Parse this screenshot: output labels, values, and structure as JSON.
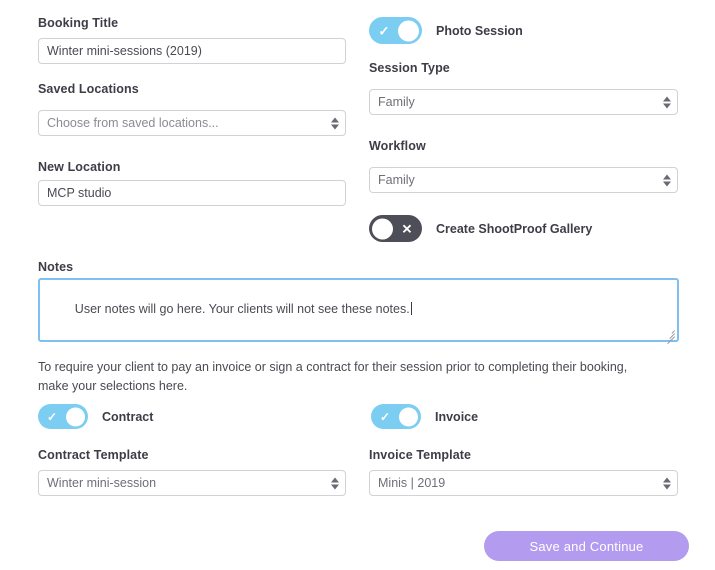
{
  "colors": {
    "toggle_on": "#7ccdf2",
    "toggle_off": "#4e4e59",
    "focus_border": "#7ec0ef",
    "primary_button": "#b39cf0",
    "label_text": "#3d3d47",
    "input_border": "#d2d2d2"
  },
  "left_column": {
    "booking_title": {
      "label": "Booking Title",
      "value": "Winter mini-sessions (2019)"
    },
    "saved_locations": {
      "label": "Saved Locations",
      "selected": "Choose from saved locations...",
      "is_placeholder": true
    },
    "new_location": {
      "label": "New Location",
      "value": "MCP studio"
    },
    "contract_template": {
      "label": "Contract Template",
      "selected": "Winter mini-session"
    }
  },
  "right_column": {
    "photo_session": {
      "label": "Photo Session",
      "state": "on",
      "mark": "✓"
    },
    "session_type": {
      "label": "Session Type",
      "selected": "Family"
    },
    "workflow": {
      "label": "Workflow",
      "selected": "Family"
    },
    "shootproof_gallery": {
      "label": "Create ShootProof Gallery",
      "state": "off",
      "mark": "✕"
    },
    "invoice_template": {
      "label": "Invoice Template",
      "selected": "Minis | 2019"
    }
  },
  "notes": {
    "label": "Notes",
    "value": "User notes will go here. Your clients will not see these notes.",
    "focused": true
  },
  "requirements": {
    "helper_text": "To require your client to pay an invoice or sign a contract for their session prior to completing their booking, make your selections here.",
    "contract_toggle": {
      "label": "Contract",
      "state": "on",
      "mark": "✓"
    },
    "invoice_toggle": {
      "label": "Invoice",
      "state": "on",
      "mark": "✓"
    }
  },
  "footer": {
    "save_button": "Save and Continue"
  }
}
